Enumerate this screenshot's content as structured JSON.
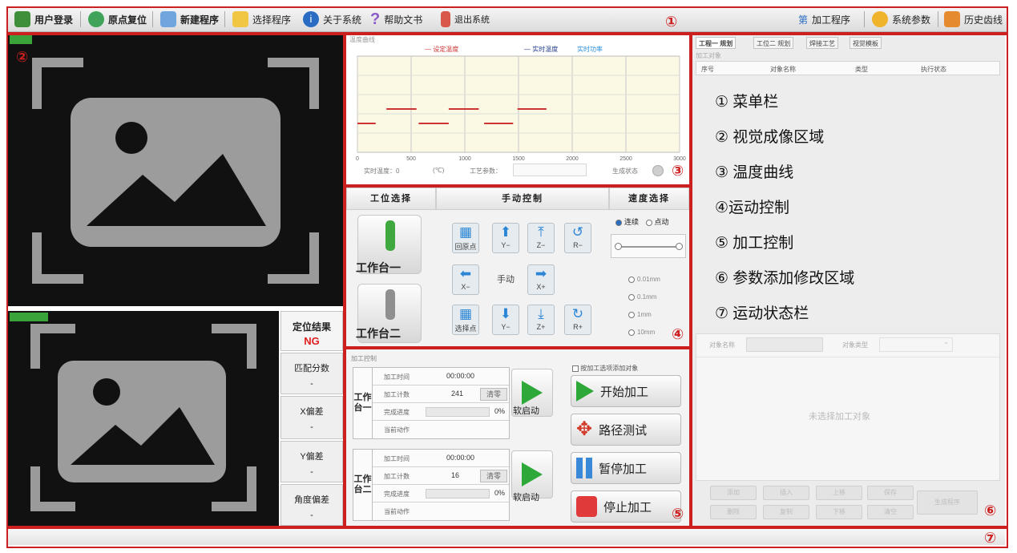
{
  "toolbar": {
    "left_items": [
      {
        "label": "用户登录",
        "icon": "user-icon"
      },
      {
        "label": "原点复位",
        "icon": "home-reset-icon"
      },
      {
        "label": "新建程序",
        "icon": "new-program-icon"
      },
      {
        "label": "选择程序",
        "icon": "folder-icon"
      },
      {
        "label": "关于系统",
        "icon": "info-icon"
      },
      {
        "label": "帮助文书",
        "icon": "help-icon"
      },
      {
        "label": "退出系统",
        "icon": "exit-icon"
      }
    ],
    "right_items": [
      {
        "label": "加工程序",
        "prefix": "第"
      },
      {
        "label": "系统参数"
      },
      {
        "label": "历史齿线"
      }
    ]
  },
  "annotations": {
    "m1": "①",
    "m2": "②",
    "m3": "③",
    "m4": "④",
    "m5": "⑤",
    "m6": "⑥",
    "m7": "⑦"
  },
  "vision": {
    "lower_label": "定位结果",
    "results": [
      {
        "label": "定位结果",
        "value": "NG"
      },
      {
        "label": "匹配分数",
        "value": "-"
      },
      {
        "label": "X偏差",
        "value": "-"
      },
      {
        "label": "Y偏差",
        "value": "-"
      },
      {
        "label": "角度偏差",
        "value": "-"
      }
    ]
  },
  "temperature": {
    "title": "温度曲线",
    "legend": [
      "设定温度",
      "实时温度",
      "实时功率"
    ],
    "footer": {
      "current_temp_label": "实时温度：0",
      "unit": "(℃)",
      "param_label": "工艺参数：",
      "status_label": "生成状态"
    }
  },
  "chart_data": {
    "type": "line",
    "x_ticks": [
      "0",
      "500",
      "1000",
      "1500",
      "2000",
      "2500",
      "3000"
    ],
    "xlim": [
      0,
      3000
    ],
    "series": [
      {
        "name": "设定温度",
        "color": "#cc3333",
        "segments": [
          [
            [
              0,
              6
            ],
            [
              170,
              6
            ]
          ],
          [
            [
              270,
              9
            ],
            [
              550,
              9
            ]
          ],
          [
            [
              570,
              6
            ],
            [
              850,
              6
            ]
          ],
          [
            [
              850,
              9
            ],
            [
              1130,
              9
            ]
          ],
          [
            [
              1180,
              6
            ],
            [
              1450,
              6
            ]
          ],
          [
            [
              1490,
              9
            ],
            [
              1760,
              9
            ]
          ]
        ]
      }
    ],
    "ylim": [
      0,
      20
    ],
    "grid": true,
    "legend_position": "top"
  },
  "motion": {
    "headers": {
      "station": "工位选择",
      "manual": "手动控制",
      "speed": "速度选择"
    },
    "stations": [
      "工作台一",
      "工作台二"
    ],
    "buttons": [
      {
        "key": "b1",
        "glyph": "▦",
        "label": "回原点"
      },
      {
        "key": "b2",
        "glyph": "⬆",
        "label": "Y−"
      },
      {
        "key": "b3",
        "glyph": "⤒",
        "label": "Z−"
      },
      {
        "key": "b4",
        "glyph": "↺",
        "label": "R−"
      },
      {
        "key": "b5",
        "glyph": "⬅",
        "label": "X−"
      },
      {
        "key": "b6",
        "glyph": "",
        "label": "手动"
      },
      {
        "key": "b7",
        "glyph": "➡",
        "label": "X+"
      },
      {
        "key": "b8",
        "glyph": "▦",
        "label": "选择点"
      },
      {
        "key": "b9",
        "glyph": "⬇",
        "label": "Y−"
      },
      {
        "key": "b10",
        "glyph": "⤓",
        "label": "Z+"
      },
      {
        "key": "b11",
        "glyph": "↻",
        "label": "R+"
      }
    ],
    "speed_modes": [
      "连续",
      "点动"
    ],
    "steps": [
      "0.01mm",
      "0.1mm",
      "1mm",
      "10mm"
    ]
  },
  "processing": {
    "title": "加工控制",
    "table1": {
      "label": "工作台一",
      "rows": [
        {
          "k": "加工时间",
          "v": "00:00:00"
        },
        {
          "k": "加工计数",
          "v": "241",
          "btn": "清零"
        },
        {
          "k": "完成进度",
          "v": "0%"
        },
        {
          "k": "当前动作",
          "v": ""
        }
      ],
      "soft_label": "软启动"
    },
    "table2": {
      "label": "工作台二",
      "rows": [
        {
          "k": "加工时间",
          "v": "00:00:00"
        },
        {
          "k": "加工计数",
          "v": "16",
          "btn": "清零"
        },
        {
          "k": "完成进度",
          "v": "0%"
        },
        {
          "k": "当前动作",
          "v": ""
        }
      ],
      "soft_label": "软启动"
    },
    "checkbox_label": "按加工选项添加对象",
    "actions": [
      {
        "label": "开始加工",
        "icon": "play-icon"
      },
      {
        "label": "路径测试",
        "icon": "move-icon"
      },
      {
        "label": "暂停加工",
        "icon": "pause-icon"
      },
      {
        "label": "停止加工",
        "icon": "stop-icon"
      }
    ]
  },
  "right_panel": {
    "tabs": [
      "工程一 规划",
      "工位二 规划",
      "焊接工艺",
      "视觉模板"
    ],
    "section_title": "加工对象",
    "table_headers": [
      "序号",
      "对象名称",
      "类型",
      "执行状态"
    ],
    "legend": [
      "① 菜单栏",
      "② 视觉成像区域",
      "③ 温度曲线",
      "④运动控制",
      "⑤ 加工控制",
      "⑥ 参数添加修改区域",
      "⑦ 运动状态栏"
    ],
    "name_label": "对象名称",
    "type_label": "对象类型",
    "empty_text": "未选择加工对象",
    "buttons": [
      "添加",
      "插入",
      "上移",
      "保存",
      "删除",
      "复制",
      "下移",
      "清空"
    ],
    "generate_label": "生成程序"
  }
}
